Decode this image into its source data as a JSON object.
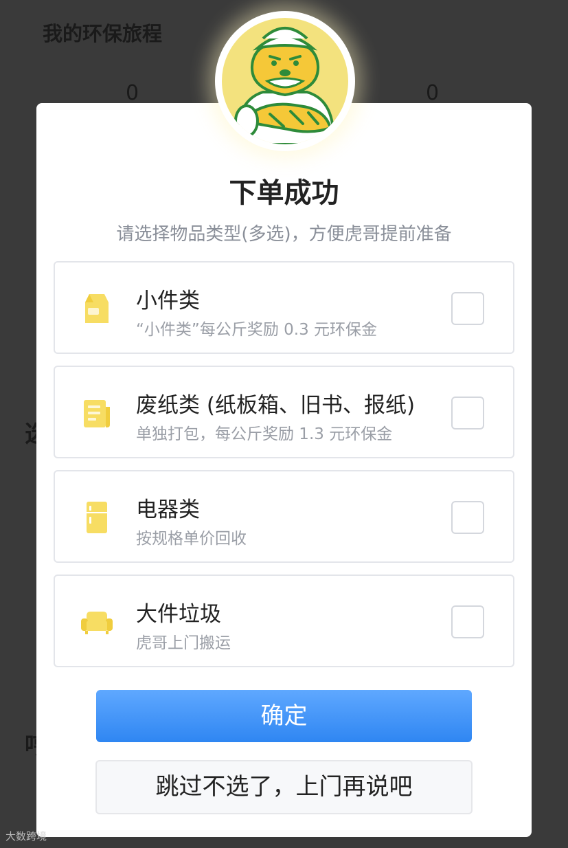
{
  "background": {
    "title": "我的环保旅程",
    "stat_left": "0",
    "stat_right": "0",
    "cut_text_1": "选",
    "cut_text_2": "哼"
  },
  "modal": {
    "title": "下单成功",
    "subtitle": "请选择物品类型(多选)，方便虎哥提前准备",
    "options": [
      {
        "icon": "milk-carton-icon",
        "label": "小件类",
        "desc": "“小件类”每公斤奖励 0.3 元环保金",
        "checked": false
      },
      {
        "icon": "newspaper-icon",
        "label": "废纸类 (纸板箱、旧书、报纸)",
        "desc": "单独打包，每公斤奖励 1.3 元环保金",
        "checked": false
      },
      {
        "icon": "refrigerator-icon",
        "label": "电器类",
        "desc": "按规格单价回收",
        "checked": false
      },
      {
        "icon": "sofa-icon",
        "label": "大件垃圾",
        "desc": "虎哥上门搬运",
        "checked": false
      }
    ],
    "confirm_label": "确定",
    "skip_label": "跳过不选了，上门再说吧"
  },
  "watermark": "大数跨境",
  "colors": {
    "accent_blue": "#2f86f2",
    "icon_yellow": "#f7dd63",
    "mascot_bg": "#f3e27e",
    "tiger_green": "#2e8b3a"
  }
}
